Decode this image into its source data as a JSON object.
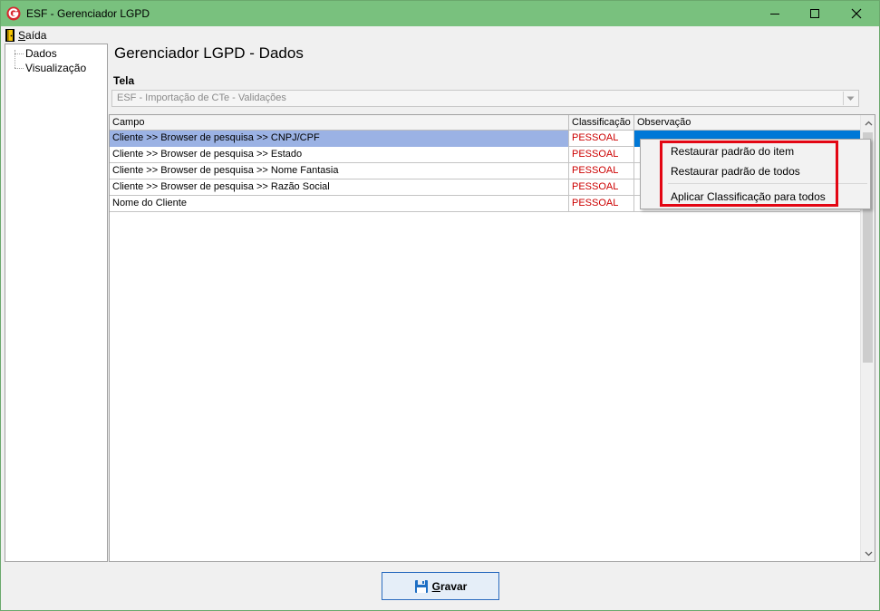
{
  "window": {
    "title": "ESF - Gerenciador LGPD",
    "titlebar_color": "#79c17e",
    "controls": {
      "minimize_icon": "minimize-icon",
      "maximize_icon": "maximize-icon",
      "close_icon": "close-icon"
    }
  },
  "menubar": {
    "items": [
      {
        "label_underlined": "S",
        "label_rest": "aída",
        "icon": "exit-door-icon"
      }
    ]
  },
  "sidebar": {
    "items": [
      {
        "label": "Dados"
      },
      {
        "label": "Visualização"
      }
    ]
  },
  "main": {
    "heading": "Gerenciador LGPD - Dados",
    "tela_label": "Tela",
    "tela_value": "ESF - Importação de CTe - Validações"
  },
  "grid": {
    "columns": [
      "Campo",
      "Classificação",
      "Observação"
    ],
    "rows": [
      {
        "campo": "Cliente >> Browser de pesquisa >> CNPJ/CPF",
        "classificacao": "PESSOAL",
        "observacao": "",
        "selected": true
      },
      {
        "campo": "Cliente >> Browser de pesquisa >> Estado",
        "classificacao": "PESSOAL",
        "observacao": ""
      },
      {
        "campo": "Cliente >> Browser de pesquisa >> Nome Fantasia",
        "classificacao": "PESSOAL",
        "observacao": ""
      },
      {
        "campo": "Cliente >> Browser de pesquisa >> Razão Social",
        "classificacao": "PESSOAL",
        "observacao": ""
      },
      {
        "campo": "Nome do Cliente",
        "classificacao": "PESSOAL",
        "observacao": ""
      }
    ],
    "classification_color": "#cc0000",
    "selection_color": "#9bb2e4"
  },
  "context_menu": {
    "items": [
      "Restaurar padrão do item",
      "Restaurar padrão de todos",
      "Aplicar Classificação para todos"
    ],
    "highlight_color": "#e30613"
  },
  "footer": {
    "save_underlined": "G",
    "save_rest": "ravar",
    "save_icon": "floppy-disk-icon"
  }
}
